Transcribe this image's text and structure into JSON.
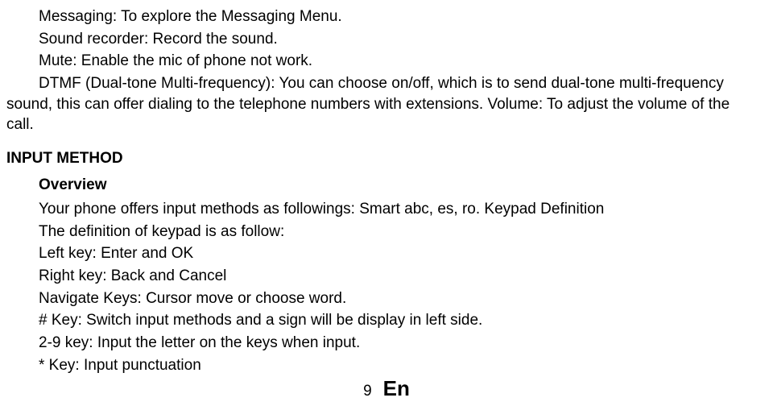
{
  "lines": {
    "messaging": "Messaging: To explore the Messaging Menu.",
    "sound_recorder": "Sound recorder: Record the sound.",
    "mute": "Mute: Enable the mic of phone not work.",
    "dtmf": "DTMF (Dual-tone Multi-frequency): You can choose on/off, which is to send dual-tone multi-frequency sound, this can offer dialing to the telephone numbers with extensions. Volume: To adjust the volume of the call."
  },
  "section": {
    "heading": "INPUT METHOD",
    "overview_label": "Overview",
    "overview_text": "Your phone offers input methods as followings: Smart abc, es, ro. Keypad Definition",
    "keypad_def": "The definition of keypad is as follow:",
    "left_key": "Left key: Enter and OK",
    "right_key": "Right key: Back and Cancel",
    "nav_keys": "Navigate Keys: Cursor move or choose word.",
    "hash_key": "# Key: Switch input methods and a sign will be display in left side.",
    "num_key": "2-9 key: Input the letter on the keys when input.",
    "star_key": "* Key: Input punctuation"
  },
  "footer": {
    "page_number": "9",
    "lang": "En"
  }
}
